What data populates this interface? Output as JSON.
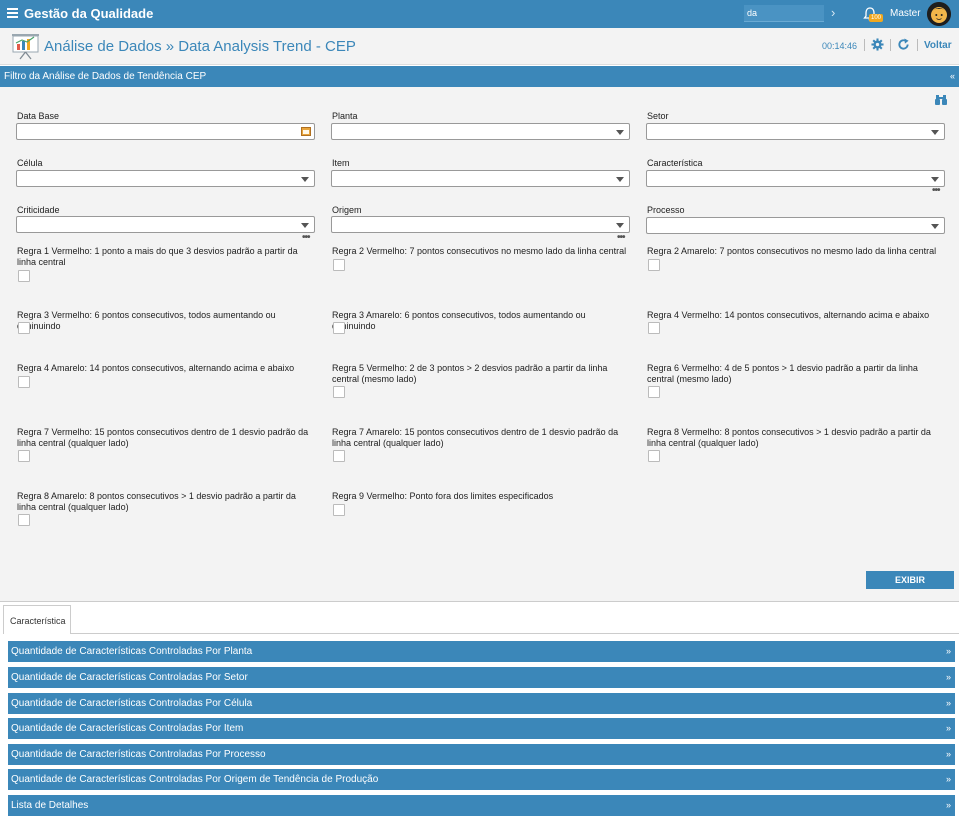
{
  "topbar": {
    "app_title": "Gestão da Qualidade",
    "search_value": "da",
    "notification_count": "100",
    "user_name": "Master"
  },
  "titlebar": {
    "page_title": "Análise de Dados » Data Analysis Trend - CEP",
    "clock": "00:14:46",
    "back_label": "Voltar"
  },
  "filter": {
    "header": "Filtro da Análise de Dados de Tendência CEP",
    "fields": {
      "data_base": "Data Base",
      "planta": "Planta",
      "setor": "Setor",
      "celula": "Célula",
      "item": "Item",
      "caracteristica": "Característica",
      "criticidade": "Criticidade",
      "origem": "Origem",
      "processo": "Processo"
    },
    "rules": [
      "Regra 1 Vermelho: 1 ponto a mais do que 3 desvios padrão a partir da linha central",
      "Regra 2 Vermelho: 7 pontos consecutivos no mesmo lado da linha central",
      "Regra 2 Amarelo: 7 pontos consecutivos no mesmo lado da linha central",
      "Regra 3 Vermelho: 6 pontos consecutivos, todos aumentando ou diminuindo",
      "Regra 3 Amarelo: 6 pontos consecutivos, todos aumentando ou diminuindo",
      "Regra 4 Vermelho: 14 pontos consecutivos, alternando acima e abaixo",
      "Regra 4 Amarelo: 14 pontos consecutivos, alternando acima e abaixo",
      "Regra 5 Vermelho: 2 de 3 pontos > 2 desvios padrão a partir da linha central (mesmo lado)",
      "Regra 6 Vermelho: 4 de 5 pontos > 1 desvio padrão a partir da linha central (mesmo lado)",
      "Regra 7 Vermelho: 15 pontos consecutivos dentro de 1 desvio padrão da linha central (qualquer lado)",
      "Regra 7 Amarelo: 15 pontos consecutivos dentro de 1 desvio padrão da linha central (qualquer lado)",
      "Regra 8 Vermelho: 8 pontos consecutivos > 1 desvio padrão a partir da linha central (qualquer lado)",
      "Regra 8 Amarelo: 8 pontos consecutivos > 1 desvio padrão a partir da linha central (qualquer lado)",
      "Regra 9 Vermelho: Ponto fora dos limites especificados"
    ],
    "exibir_label": "EXIBIR"
  },
  "tabs": [
    {
      "label": "Característica"
    }
  ],
  "accordion": [
    "Quantidade de Características Controladas Por Planta",
    "Quantidade de Características Controladas Por Setor",
    "Quantidade de Características Controladas Por Célula",
    "Quantidade de Características Controladas Por Item",
    "Quantidade de Características Controladas Por Processo",
    "Quantidade de Características Controladas Por Origem de Tendência de Produção",
    "Lista de Detalhes"
  ],
  "colors": {
    "primary": "#3b87b9",
    "panel_bg": "#f3f3f3",
    "badge": "#f0a820"
  }
}
